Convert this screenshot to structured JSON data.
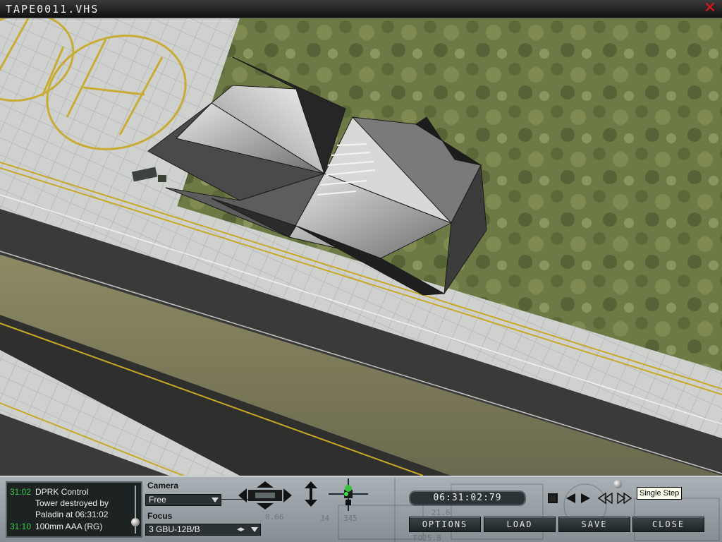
{
  "window": {
    "title": "TAPE0011.VHS",
    "close_icon": "close-x-icon"
  },
  "event_log": [
    {
      "time": "31:02",
      "lines": [
        "DPRK Control",
        "Tower destroyed by",
        "Paladin at 06:31:02"
      ]
    },
    {
      "time": "31:10",
      "lines": [
        "100mm AAA (RG)"
      ]
    }
  ],
  "camera": {
    "label": "Camera",
    "value": "Free"
  },
  "focus": {
    "label": "Focus",
    "value": "3 GBU-12B/B"
  },
  "playback": {
    "timecode": "06:31:02:79",
    "tooltip": "Single Step"
  },
  "buttons": {
    "options": "OPTIONS",
    "load": "LOAD",
    "save": "SAVE",
    "close": "CLOSE"
  },
  "hud_overlay": [
    "21.6",
    "0.66",
    "34",
    "345",
    "FO25.8"
  ],
  "colors": {
    "log_time": "#33cc44",
    "close_x": "#e01818",
    "helipad_marking": "#c8a826"
  }
}
